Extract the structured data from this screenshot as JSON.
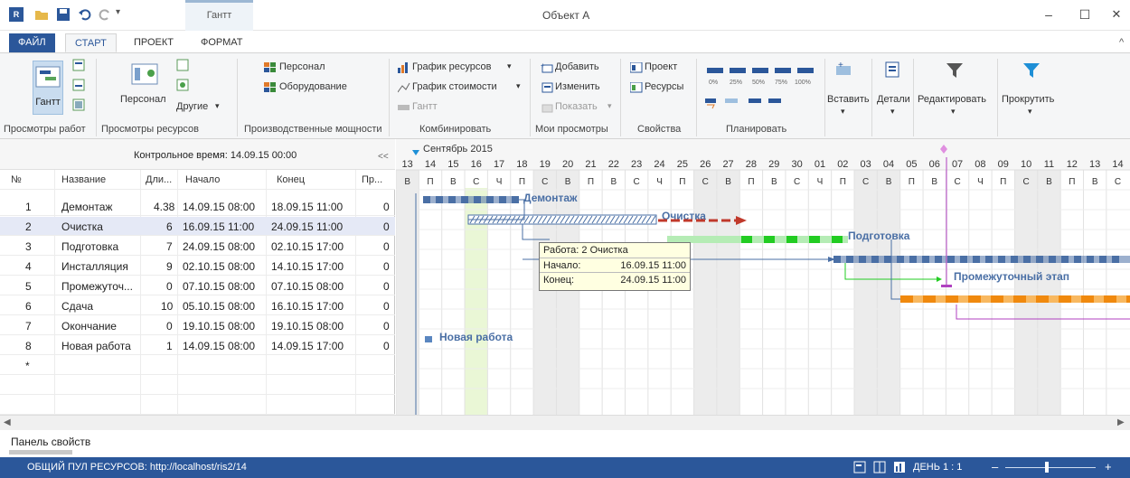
{
  "window": {
    "title": "Объект А",
    "context_tab": "Гантт",
    "minimize": "–",
    "maximize": "☐",
    "close": "✕",
    "collapse": "^"
  },
  "tabs": {
    "file": "ФАЙЛ",
    "start": "СТАРТ",
    "project": "ПРОЕКТ",
    "format": "ФОРМАТ"
  },
  "ribbon": {
    "views": {
      "gantt": "Гантт",
      "label": "Просмотры работ"
    },
    "resources": {
      "personal": "Персонал",
      "others": "Другие",
      "label": "Просмотры ресурсов"
    },
    "capacity": {
      "staff": "Персонал",
      "equipment": "Оборудование",
      "label": "Производственные мощности"
    },
    "combine": {
      "resource_chart": "График ресурсов",
      "cost_chart": "График стоимости",
      "gantt": "Гантт",
      "label": "Комбинировать"
    },
    "myviews": {
      "add": "Добавить",
      "edit": "Изменить",
      "show": "Показать",
      "label": "Мои просмотры"
    },
    "props": {
      "project": "Проект",
      "resources": "Ресурсы",
      "label": "Свойства"
    },
    "plan": {
      "p0": "0%",
      "p25": "25%",
      "p50": "50%",
      "p75": "75%",
      "p100": "100%",
      "label": "Планировать"
    },
    "insert": "Вставить",
    "details": "Детали",
    "edit": "Редактировать",
    "scroll": "Прокрутить"
  },
  "grid": {
    "control_time": "Контрольное время: 14.09.15 00:00",
    "collapse": "<<",
    "headers": {
      "num": "№",
      "name": "Название",
      "dur": "Дли...",
      "start": "Начало",
      "end": "Конец",
      "pr": "Пр..."
    },
    "rows": [
      {
        "num": "1",
        "name": "Демонтаж",
        "dur": "4.38",
        "start": "14.09.15 08:00",
        "end": "18.09.15 11:00",
        "pr": "0"
      },
      {
        "num": "2",
        "name": "Очистка",
        "dur": "6",
        "start": "16.09.15 11:00",
        "end": "24.09.15 11:00",
        "pr": "0"
      },
      {
        "num": "3",
        "name": "Подготовка",
        "dur": "7",
        "start": "24.09.15 08:00",
        "end": "02.10.15 17:00",
        "pr": "0"
      },
      {
        "num": "4",
        "name": "Инсталляция",
        "dur": "9",
        "start": "02.10.15 08:00",
        "end": "14.10.15 17:00",
        "pr": "0"
      },
      {
        "num": "5",
        "name": "Промежуточ...",
        "dur": "0",
        "start": "07.10.15 08:00",
        "end": "07.10.15 08:00",
        "pr": "0"
      },
      {
        "num": "6",
        "name": "Сдача",
        "dur": "10",
        "start": "05.10.15 08:00",
        "end": "16.10.15 17:00",
        "pr": "0"
      },
      {
        "num": "7",
        "name": "Окончание",
        "dur": "0",
        "start": "19.10.15 08:00",
        "end": "19.10.15 08:00",
        "pr": "0"
      },
      {
        "num": "8",
        "name": "Новая работа",
        "dur": "1",
        "start": "14.09.15 08:00",
        "end": "14.09.15 17:00",
        "pr": "0"
      }
    ],
    "new_row": "*"
  },
  "gantt": {
    "month": "Сентябрь 2015",
    "dates": [
      "13",
      "14",
      "15",
      "16",
      "17",
      "18",
      "19",
      "20",
      "21",
      "22",
      "23",
      "24",
      "25",
      "26",
      "27",
      "28",
      "29",
      "30",
      "01",
      "02",
      "03",
      "04",
      "05",
      "06",
      "07",
      "08",
      "09",
      "10",
      "11",
      "12",
      "13",
      "14"
    ],
    "weekdays": [
      "В",
      "П",
      "В",
      "С",
      "Ч",
      "П",
      "С",
      "В",
      "П",
      "В",
      "С",
      "Ч",
      "П",
      "С",
      "В",
      "П",
      "В",
      "С",
      "Ч",
      "П",
      "С",
      "В",
      "П",
      "В",
      "С",
      "Ч",
      "П",
      "С",
      "В",
      "П",
      "В",
      "С"
    ],
    "labels": {
      "demontazh": "Демонтаж",
      "ochistka": "Очистка",
      "podgotovka": "Подготовка",
      "milestone": "Промежуточный этап",
      "new_task": "Новая работа"
    },
    "tooltip": {
      "title": "Работа: 2 Очистка",
      "start_label": "Начало:",
      "start_value": "16.09.15 11:00",
      "end_label": "Конец:",
      "end_value": "24.09.15 11:00"
    },
    "colors": {
      "blue": "#4a6fa5",
      "green": "#22cc22",
      "orange": "#f0890e",
      "red": "#c0392b",
      "purple": "#b040c0"
    }
  },
  "properties_panel": "Панель свойств",
  "status": {
    "pool": "ОБЩИЙ ПУЛ РЕСУРСОВ: http://localhost/ris2/14",
    "zoom": "ДЕНЬ 1 : 1",
    "minus": "–",
    "plus": "+"
  }
}
